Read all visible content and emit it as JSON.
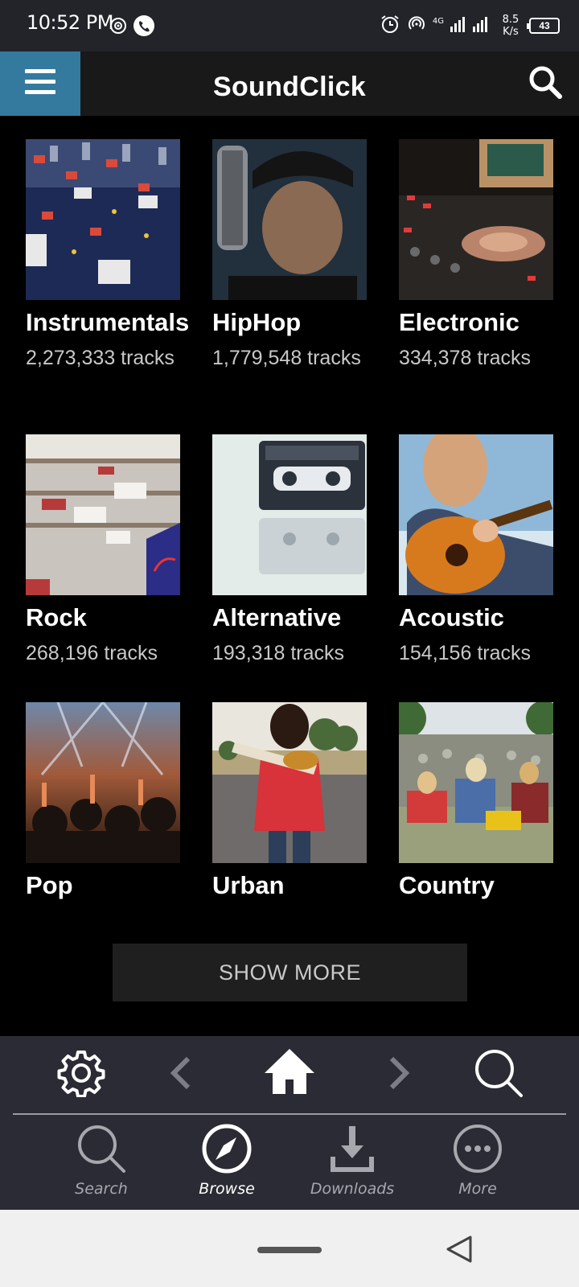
{
  "status_bar": {
    "time": "10:52 PM",
    "network": "4G",
    "speed_value": "8.5",
    "speed_unit": "K/s",
    "battery": "43"
  },
  "app_bar": {
    "title": "SoundClick"
  },
  "genres": [
    {
      "name": "Instrumentals",
      "count": "2,273,333 tracks"
    },
    {
      "name": "HipHop",
      "count": "1,779,548 tracks"
    },
    {
      "name": "Electronic",
      "count": "334,378 tracks"
    },
    {
      "name": "Rock",
      "count": "268,196 tracks"
    },
    {
      "name": "Alternative",
      "count": "193,318 tracks"
    },
    {
      "name": "Acoustic",
      "count": "154,156 tracks"
    },
    {
      "name": "Pop",
      "count": ""
    },
    {
      "name": "Urban",
      "count": ""
    },
    {
      "name": "Country",
      "count": ""
    }
  ],
  "show_more_label": "SHOW MORE",
  "toolbar": {
    "icons": [
      "gear-icon",
      "chevron-left-icon",
      "home-icon",
      "chevron-right-icon",
      "search-icon"
    ]
  },
  "bottom_nav": [
    {
      "label": "Search",
      "icon": "search-icon"
    },
    {
      "label": "Browse",
      "icon": "compass-icon",
      "active": true
    },
    {
      "label": "Downloads",
      "icon": "download-icon"
    },
    {
      "label": "More",
      "icon": "more-icon"
    }
  ],
  "colors": {
    "menu_accent": "#347a9e",
    "app_bar_bg": "#191919",
    "toolbar_bg": "#2a2b34",
    "status_bar_bg": "#22242a"
  }
}
